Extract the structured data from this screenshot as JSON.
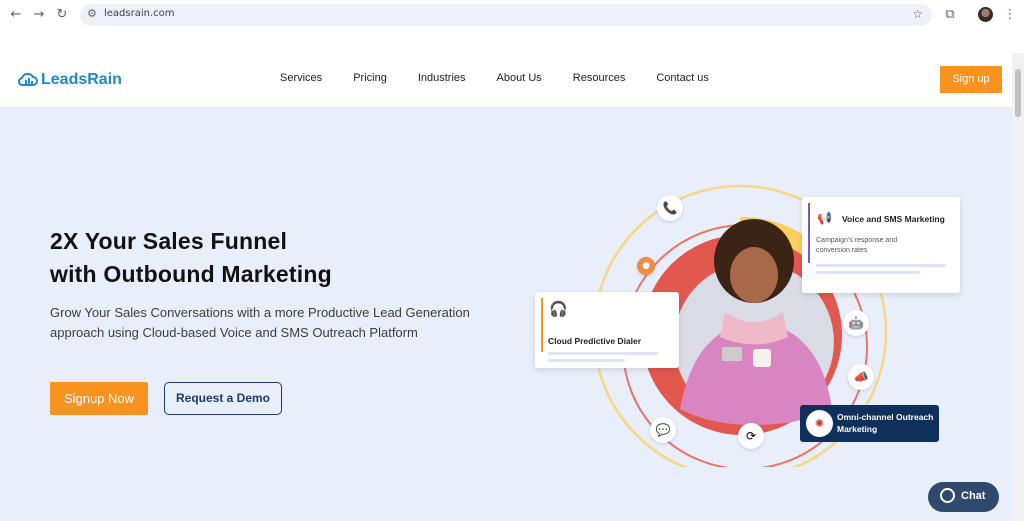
{
  "browser": {
    "url": "leadsrain.com",
    "icons": [
      "back-arrow-icon",
      "forward-arrow-icon",
      "reload-icon",
      "site-settings-icon",
      "bookmark-star-icon",
      "extensions-icon",
      "menu-kebab-icon"
    ]
  },
  "header": {
    "logo_text": "LeadsRain",
    "menu": [
      "Services",
      "Pricing",
      "Industries",
      "About Us",
      "Resources",
      "Contact us"
    ],
    "signup_label": "Sign up"
  },
  "hero": {
    "headline_line1": "2X Your Sales Funnel",
    "headline_line2": "with Outbound Marketing",
    "subtext": "Grow Your Sales Conversations with a more Productive Lead Generation approach using Cloud-based Voice and SMS Outreach Platform",
    "primary_cta": "Signup Now",
    "secondary_cta": "Request a Demo"
  },
  "illustration": {
    "voice_sms_title": "Voice and SMS Marketing",
    "voice_sms_sub": "Campaign's response and conversion rates",
    "dialer_title": "Cloud Predictive Dialer",
    "omni_title": "Omni-channel Outreach Marketing"
  },
  "chat": {
    "label": "Chat"
  },
  "colors": {
    "brand_blue": "#1e88c8",
    "accent_orange": "#f7931e",
    "hero_bg": "#e8eefa",
    "navy": "#10305c"
  }
}
